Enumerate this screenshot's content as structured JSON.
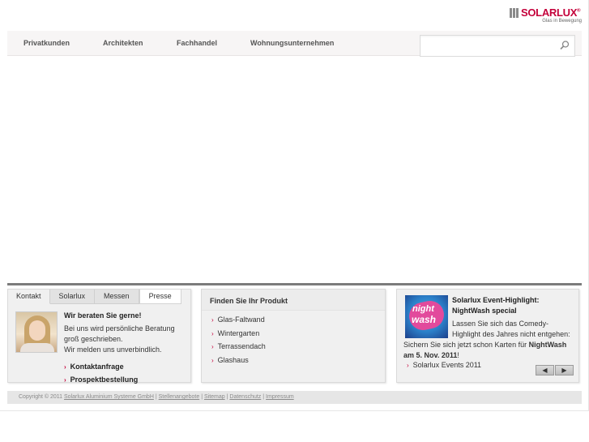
{
  "brand": {
    "name": "SOLARLUX",
    "registered": "®",
    "tagline": "Glas in Bewegung",
    "color": "#c4003a"
  },
  "nav": {
    "items": [
      {
        "label": "Privatkunden"
      },
      {
        "label": "Architekten"
      },
      {
        "label": "Fachhandel"
      },
      {
        "label": "Wohnungsunternehmen"
      }
    ],
    "search": {
      "value": "",
      "icon": "search-icon"
    }
  },
  "kontakt": {
    "tabs": [
      {
        "label": "Kontakt"
      },
      {
        "label": "Solarlux"
      },
      {
        "label": "Messen"
      },
      {
        "label": "Presse"
      }
    ],
    "heading": "Wir beraten Sie gerne!",
    "text_line1": "Bei uns wird persönliche Beratung",
    "text_line2": "groß geschrieben.",
    "text_line3": "Wir melden uns unverbindlich.",
    "links": [
      {
        "label": "Kontaktanfrage"
      },
      {
        "label": "Prospektbestellung"
      }
    ]
  },
  "produkt": {
    "heading": "Finden Sie Ihr Produkt",
    "links": [
      {
        "label": "Glas-Faltwand"
      },
      {
        "label": "Wintergarten"
      },
      {
        "label": "Terrassendach"
      },
      {
        "label": "Glashaus"
      }
    ]
  },
  "event": {
    "image_text_1": "night",
    "image_text_2": "wash",
    "title_line1": "Solarlux Event-Highlight:",
    "title_line2": "NightWash special",
    "text_line1": "Lassen Sie sich das Comedy-",
    "text_line2": "Highlight des Jahres nicht entgehen:",
    "text_line3_a": "Sichern Sie sich jetzt schon Karten für ",
    "text_line3_b": "NightWash",
    "text_line4_a": "am 5. Nov. 2011",
    "text_line4_b": "!",
    "link": "Solarlux Events 2011",
    "pager_prev": "◀",
    "pager_next": "▶"
  },
  "footer": {
    "copyright": "Copyright © 2011",
    "links": [
      {
        "label": "Solarlux Aluminium Systeme GmbH"
      },
      {
        "label": "Stellenangebote"
      },
      {
        "label": "Sitemap"
      },
      {
        "label": "Datenschutz"
      },
      {
        "label": "Impressum"
      }
    ],
    "separator": "|"
  }
}
